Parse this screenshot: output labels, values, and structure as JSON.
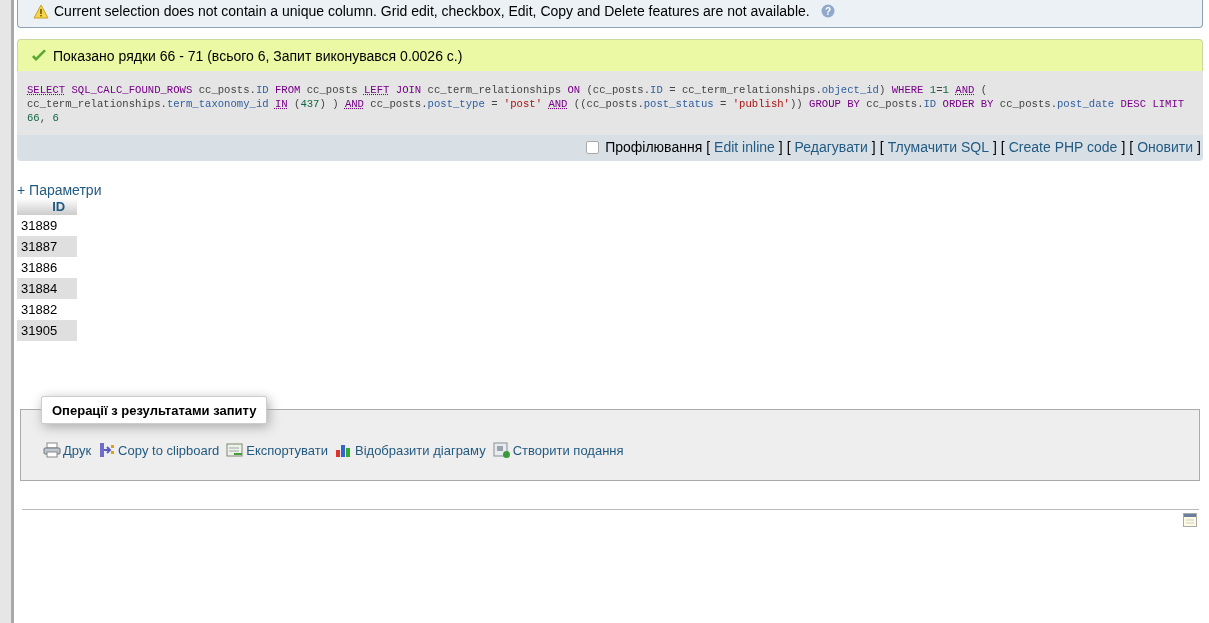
{
  "warning": {
    "text": "Current selection does not contain a unique column. Grid edit, checkbox, Edit, Copy and Delete features are not available.",
    "help": "?"
  },
  "success": {
    "text": "Показано рядки 66 - 71 (всього 6, Запит виконувався 0.0026 с.)"
  },
  "sql": [
    {
      "kind": "reserved",
      "text": "SELECT"
    },
    {
      "kind": "keyword",
      "text": " SQL_CALC_FOUND_ROWS"
    },
    {
      "kind": "plain",
      "text": " cc_posts."
    },
    {
      "kind": "field",
      "text": "ID"
    },
    {
      "kind": "keyword",
      "text": " FROM"
    },
    {
      "kind": "plain",
      "text": " cc_posts "
    },
    {
      "kind": "reserved",
      "text": "LEFT"
    },
    {
      "kind": "keyword",
      "text": " JOIN"
    },
    {
      "kind": "plain",
      "text": " cc_term_relationships "
    },
    {
      "kind": "keyword",
      "text": "ON"
    },
    {
      "kind": "plain",
      "text": " (cc_posts."
    },
    {
      "kind": "field",
      "text": "ID"
    },
    {
      "kind": "plain",
      "text": " = cc_term_relationships."
    },
    {
      "kind": "field",
      "text": "object_id"
    },
    {
      "kind": "plain",
      "text": ") "
    },
    {
      "kind": "keyword",
      "text": "WHERE "
    },
    {
      "kind": "number",
      "text": "1"
    },
    {
      "kind": "plain",
      "text": "="
    },
    {
      "kind": "number",
      "text": "1 "
    },
    {
      "kind": "reserved",
      "text": "AND"
    },
    {
      "kind": "plain",
      "text": " ( cc_term_relationships."
    },
    {
      "kind": "field",
      "text": "term_taxonomy_id "
    },
    {
      "kind": "reserved",
      "text": "IN"
    },
    {
      "kind": "plain",
      "text": " ("
    },
    {
      "kind": "number",
      "text": "437"
    },
    {
      "kind": "plain",
      "text": ") ) "
    },
    {
      "kind": "reserved",
      "text": "AND"
    },
    {
      "kind": "plain",
      "text": " cc_posts."
    },
    {
      "kind": "field",
      "text": "post_type"
    },
    {
      "kind": "plain",
      "text": " = "
    },
    {
      "kind": "string",
      "text": "'post' "
    },
    {
      "kind": "reserved",
      "text": "AND"
    },
    {
      "kind": "plain",
      "text": " ((cc_posts."
    },
    {
      "kind": "field",
      "text": "post_status"
    },
    {
      "kind": "plain",
      "text": " = "
    },
    {
      "kind": "string",
      "text": "'publish'"
    },
    {
      "kind": "plain",
      "text": ")) "
    },
    {
      "kind": "keyword",
      "text": "GROUP BY"
    },
    {
      "kind": "plain",
      "text": " cc_posts."
    },
    {
      "kind": "field",
      "text": "ID"
    },
    {
      "kind": "keyword",
      "text": " ORDER BY"
    },
    {
      "kind": "plain",
      "text": " cc_posts."
    },
    {
      "kind": "field",
      "text": "post_date"
    },
    {
      "kind": "keyword",
      "text": " DESC"
    },
    {
      "kind": "keyword",
      "text": " LIMIT "
    },
    {
      "kind": "number",
      "text": "66"
    },
    {
      "kind": "plain",
      "text": ", "
    },
    {
      "kind": "number",
      "text": "6"
    }
  ],
  "toolbar": {
    "profiling": {
      "label": "Профілювання",
      "checked": false
    },
    "links": [
      {
        "open": "[",
        "label": "Edit inline",
        "close": "]"
      },
      {
        "open": "[",
        "label": "Редагувати",
        "close": "]"
      },
      {
        "open": "[",
        "label": "Тлумачити SQL",
        "close": "]"
      },
      {
        "open": "[",
        "label": "Create PHP code",
        "close": "]"
      },
      {
        "open": "[",
        "label": "Оновити",
        "close": "]"
      }
    ]
  },
  "options_link": "+ Параметри",
  "table": {
    "columns": [
      "ID"
    ],
    "rows": [
      [
        "31889"
      ],
      [
        "31887"
      ],
      [
        "31886"
      ],
      [
        "31884"
      ],
      [
        "31882"
      ],
      [
        "31905"
      ]
    ]
  },
  "operations": {
    "legend": "Операції з результатами запиту",
    "actions": [
      {
        "kind": "print",
        "label": "Друк"
      },
      {
        "kind": "copy",
        "label": "Copy to clipboard"
      },
      {
        "kind": "export",
        "label": "Експортувати"
      },
      {
        "kind": "chart",
        "label": "Відобразити діаграму"
      },
      {
        "kind": "view",
        "label": "Створити подання"
      }
    ]
  }
}
